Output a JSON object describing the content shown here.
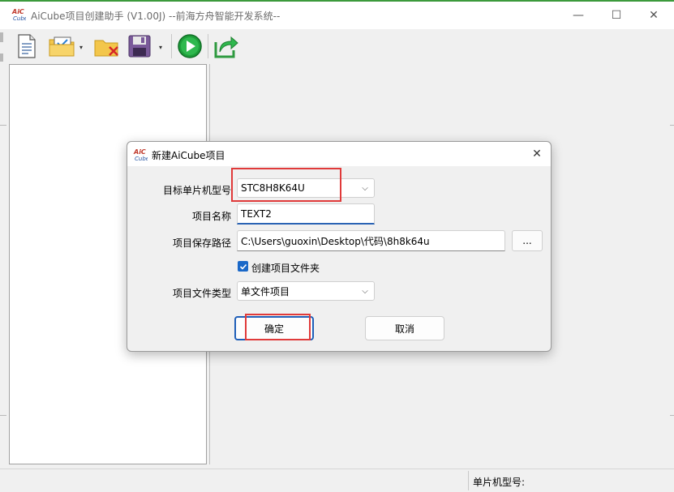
{
  "window": {
    "title": "AiCube项目创建助手 (V1.00J) --前海方舟智能开发系统--",
    "minimize": "—",
    "maximize": "☐",
    "close": "✕",
    "logo_text": "AiC Cube"
  },
  "toolbar": {
    "items": [
      {
        "name": "new-document-icon"
      },
      {
        "name": "open-folder-icon"
      },
      {
        "name": "delete-folder-icon"
      },
      {
        "name": "save-icon"
      },
      {
        "name": "run-icon"
      },
      {
        "name": "export-icon"
      }
    ],
    "dropdown_glyph": "▾"
  },
  "status_bar": {
    "mcu_label": "单片机型号:"
  },
  "dialog": {
    "title": "新建AiCube项目",
    "close": "✕",
    "fields": {
      "mcu_model_label": "目标单片机型号",
      "mcu_model_value": "STC8H8K64U",
      "project_name_label": "项目名称",
      "project_name_value": "TEXT2",
      "save_path_label": "项目保存路径",
      "save_path_value": "C:\\Users\\guoxin\\Desktop\\代码\\8h8k64u",
      "browse_label": "...",
      "create_folder_label": "创建项目文件夹",
      "create_folder_checked": true,
      "file_type_label": "项目文件类型",
      "file_type_value": "单文件项目"
    },
    "ok_label": "确定",
    "cancel_label": "取消",
    "caret_glyph": "⌵"
  },
  "colors": {
    "highlight": "#e03a3a",
    "accent": "#1a68c8",
    "title_border": "#3c9a3c"
  }
}
